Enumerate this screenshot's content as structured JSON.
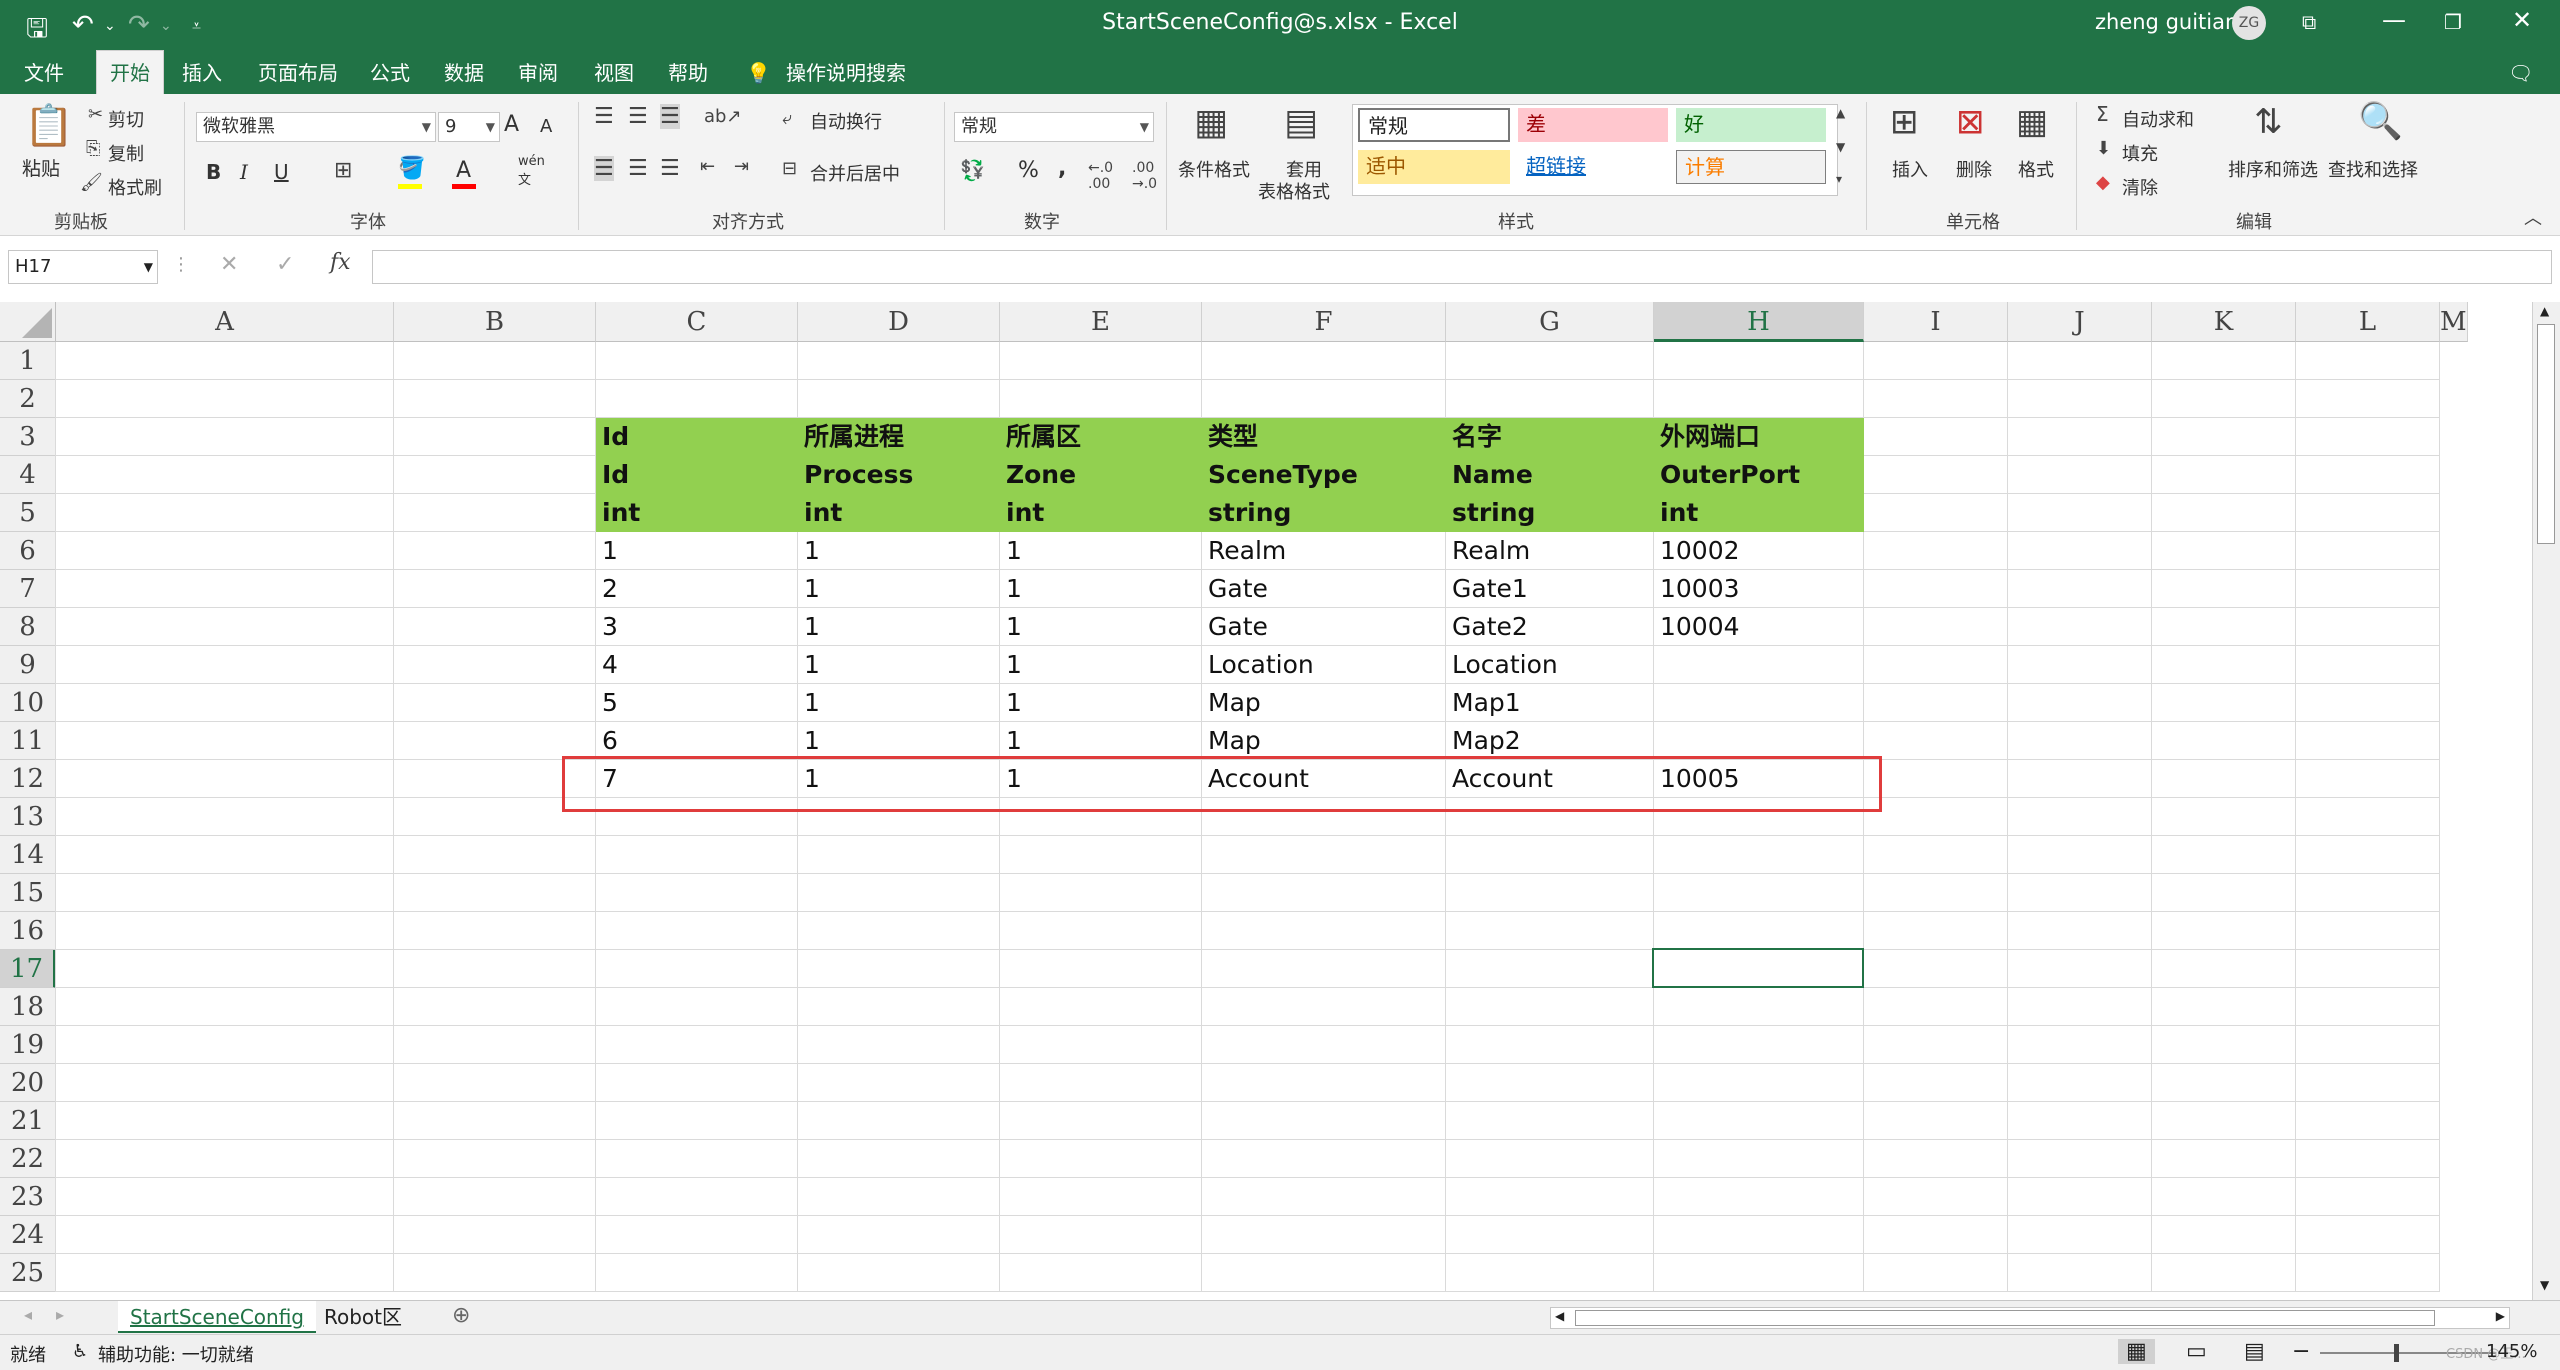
{
  "titlebar": {
    "title": "StartSceneConfig@s.xlsx  -  Excel",
    "user": "zheng guitian",
    "avatar": "ZG",
    "icons": [
      "save-icon",
      "undo-icon",
      "redo-icon",
      "customize-icon",
      "ribbon-display-icon",
      "minimize-icon",
      "restore-icon",
      "close-icon"
    ]
  },
  "menu": {
    "tabs": [
      "文件",
      "开始",
      "插入",
      "页面布局",
      "公式",
      "数据",
      "审阅",
      "视图",
      "帮助"
    ],
    "active": "开始",
    "search": "操作说明搜索"
  },
  "ribbon": {
    "clipboard": {
      "paste": "粘贴",
      "cut": "剪切",
      "copy": "复制",
      "format_painter": "格式刷",
      "label": "剪贴板"
    },
    "font": {
      "name": "微软雅黑",
      "size": "9",
      "bold": "B",
      "italic": "I",
      "underline": "U",
      "label": "字体",
      "inc": "A",
      "dec": "A",
      "phonetic_top": "wén",
      "phonetic_bottom": "文"
    },
    "alignment": {
      "wrap": "自动换行",
      "merge": "合并后居中",
      "label": "对齐方式"
    },
    "number": {
      "format": "常规",
      "percent": "%",
      "comma": ",",
      "label": "数字"
    },
    "styles": {
      "conditional": "条件格式",
      "table_top": "套用",
      "table_bottom": "表格格式",
      "cells": [
        {
          "text": "常规",
          "bg": "#ffffff",
          "fg": "#222222"
        },
        {
          "text": "差",
          "bg": "#ffc7ce",
          "fg": "#9c0006"
        },
        {
          "text": "好",
          "bg": "#c6efce",
          "fg": "#006100"
        },
        {
          "text": "适中",
          "bg": "#ffeb9c",
          "fg": "#9c5700"
        },
        {
          "text": "超链接",
          "bg": "#ffffff",
          "fg": "#0563c1"
        },
        {
          "text": "计算",
          "bg": "#f2f2f2",
          "fg": "#fa7d00"
        }
      ],
      "label": "样式"
    },
    "cells": {
      "insert": "插入",
      "delete": "删除",
      "format": "格式",
      "label": "单元格"
    },
    "editing": {
      "autosum": "自动求和",
      "fill": "填充",
      "clear": "清除",
      "sort": "排序和筛选",
      "find": "查找和选择",
      "label": "编辑"
    }
  },
  "formula": {
    "namebox": "H17",
    "fx": "fx",
    "value": ""
  },
  "sheet": {
    "columns": [
      "A",
      "B",
      "C",
      "D",
      "E",
      "F",
      "G",
      "H",
      "I",
      "J",
      "K",
      "L",
      "M"
    ],
    "rows": [
      "1",
      "2",
      "3",
      "4",
      "5",
      "6",
      "7",
      "8",
      "9",
      "10",
      "11",
      "12",
      "13",
      "14",
      "15",
      "16",
      "17",
      "18",
      "19",
      "20",
      "21",
      "22",
      "23",
      "24",
      "25"
    ],
    "selected_col": "H",
    "selected_row": "17",
    "header_rows": [
      [
        "Id",
        "所属进程",
        "所属区",
        "类型",
        "名字",
        "外网端口"
      ],
      [
        "Id",
        "Process",
        "Zone",
        "SceneType",
        "Name",
        "OuterPort"
      ],
      [
        "int",
        "int",
        "int",
        "string",
        "string",
        "int"
      ]
    ],
    "data_rows": [
      [
        "1",
        "1",
        "1",
        "Realm",
        "Realm",
        "10002"
      ],
      [
        "2",
        "1",
        "1",
        "Gate",
        "Gate1",
        "10003"
      ],
      [
        "3",
        "1",
        "1",
        "Gate",
        "Gate2",
        "10004"
      ],
      [
        "4",
        "1",
        "1",
        "Location",
        "Location",
        ""
      ],
      [
        "5",
        "1",
        "1",
        "Map",
        "Map1",
        ""
      ],
      [
        "6",
        "1",
        "1",
        "Map",
        "Map2",
        ""
      ],
      [
        "7",
        "1",
        "1",
        "Account",
        "Account",
        "10005"
      ]
    ],
    "header_color": "#92d050",
    "highlight_color": "#e03c3c"
  },
  "sheet_tabs": [
    "StartSceneConfig",
    "Robot区"
  ],
  "status": {
    "ready": "就绪",
    "accessibility": "辅助功能: 一切就绪",
    "zoom": "145%",
    "watermark": "CSDN @王..."
  }
}
